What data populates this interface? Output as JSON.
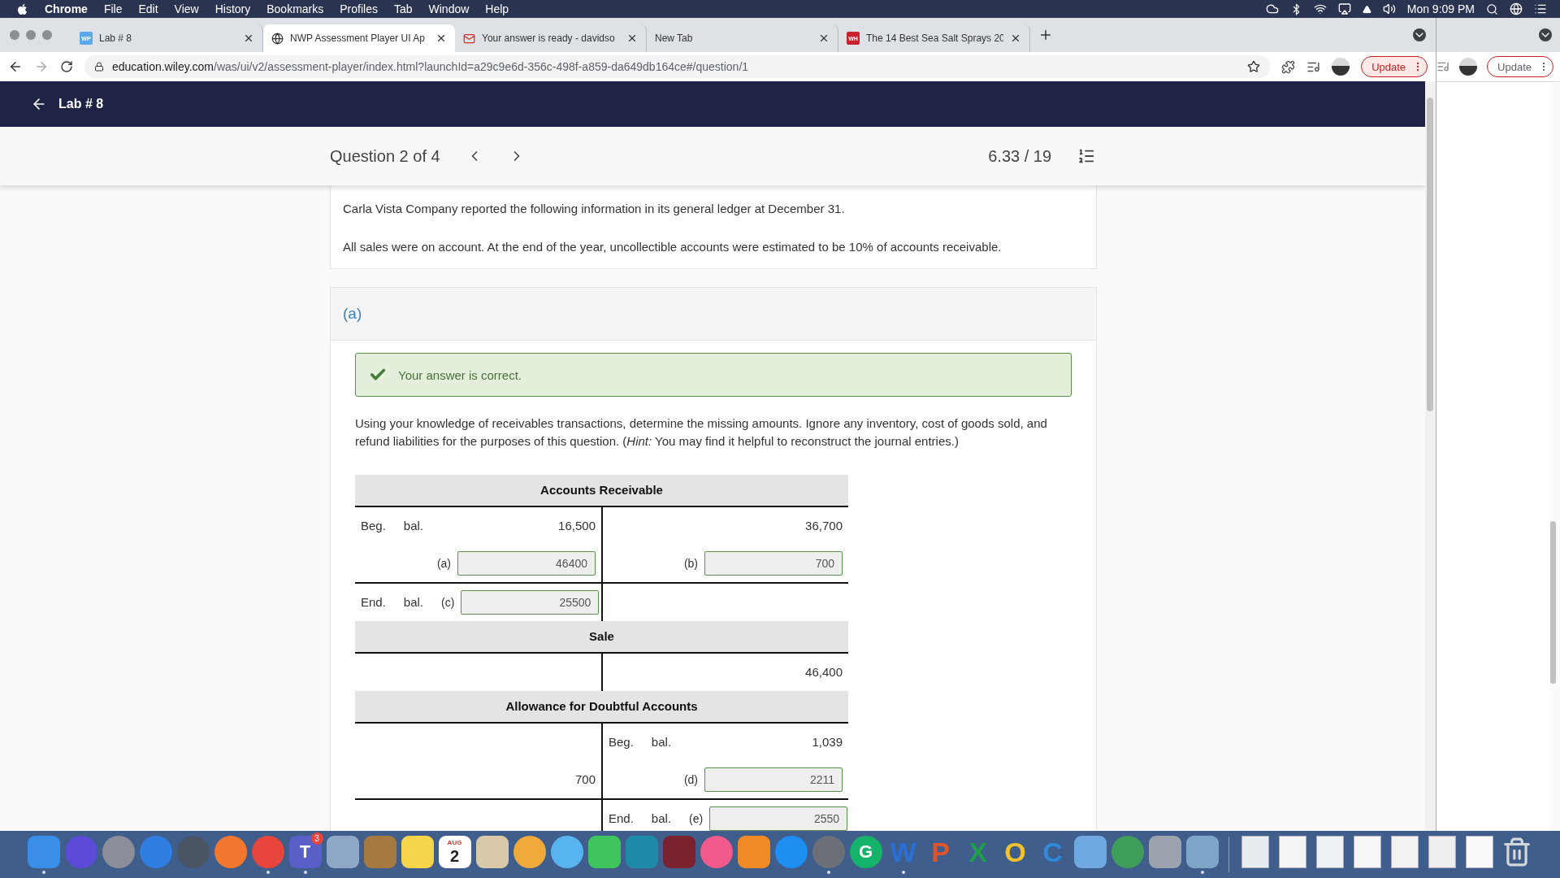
{
  "menubar": {
    "app": "Chrome",
    "items": [
      "File",
      "Edit",
      "View",
      "History",
      "Bookmarks",
      "Profiles",
      "Tab",
      "Window",
      "Help"
    ],
    "clock": "Mon 9:09 PM"
  },
  "tabs": [
    {
      "title": "Lab # 8",
      "kind": "badge",
      "icon_text": "WP",
      "selected": false
    },
    {
      "title": "NWP Assessment Player UI Ap",
      "kind": "globe",
      "selected": true
    },
    {
      "title": "Your answer is ready - davidso",
      "kind": "mail",
      "selected": false
    },
    {
      "title": "New Tab",
      "kind": "plain",
      "selected": false
    },
    {
      "title": "The 14 Best Sea Salt Sprays 20",
      "kind": "badge",
      "icon_text": "WH",
      "selected": false
    }
  ],
  "address": {
    "host": "education.wiley.com",
    "path": "/was/ui/v2/assessment-player/index.html?launchId=a29c9e6d-356c-498f-a859-da649db164ce#/question/1"
  },
  "update_button": "Update",
  "back_window": {
    "update_button": "Update"
  },
  "page": {
    "back_label": "Lab # 8",
    "question": "Question 2 of 4",
    "score": "6.33 / 19",
    "intro": [
      "Carla Vista Company reported the following information in its general ledger at December 31.",
      "All sales were on account. At the end of the year, uncollectible accounts were estimated to be 10% of accounts receivable."
    ],
    "part": {
      "label": "(a)",
      "feedback": {
        "correct": true,
        "text": "Your answer is correct."
      },
      "instructions": "Using your knowledge of receivables transactions, determine the missing amounts. Ignore any inventory, cost of goods sold, and refund liabilities for the purposes of this question. (*Hint:* You may find it helpful to reconstruct the journal entries.)",
      "accounts": [
        {
          "title": "Accounts Receivable",
          "rows": [
            [
              {
                "kind": "amount",
                "labels": [
                  "Beg.",
                  "bal."
                ],
                "value": "16,500"
              },
              {
                "kind": "amount",
                "value": "36,700"
              }
            ],
            [
              {
                "kind": "input",
                "letter": "(a)",
                "value": "46400"
              },
              {
                "kind": "input",
                "letter": "(b)",
                "value": "700"
              }
            ]
          ],
          "balance_rows": [
            [
              {
                "kind": "input",
                "labels": [
                  "End.",
                  "bal."
                ],
                "letter": "(c)",
                "value": "25500"
              },
              {
                "kind": "empty"
              }
            ]
          ]
        },
        {
          "title": "Sale",
          "rows": [
            [
              {
                "kind": "empty"
              },
              {
                "kind": "amount",
                "value": "46,400"
              }
            ]
          ]
        },
        {
          "title": "Allowance for Doubtful Accounts",
          "rows": [
            [
              {
                "kind": "empty"
              },
              {
                "kind": "amount",
                "labels": [
                  "Beg.",
                  "bal."
                ],
                "value": "1,039"
              }
            ],
            [
              {
                "kind": "amount",
                "value": "700"
              },
              {
                "kind": "input",
                "letter": "(d)",
                "value": "2211"
              }
            ]
          ],
          "balance_rows": [
            [
              {
                "kind": "empty"
              },
              {
                "kind": "input",
                "labels": [
                  "End.",
                  "bal."
                ],
                "letter": "(e)",
                "value": "2550"
              }
            ]
          ]
        }
      ]
    }
  },
  "dock": [
    {
      "kind": "app",
      "color": "#3a8ee6",
      "running": true
    },
    {
      "kind": "round",
      "color": "#5b4bd6",
      "running": false
    },
    {
      "kind": "round",
      "color": "#8a8f99",
      "running": false
    },
    {
      "kind": "round",
      "color": "#2e7de0",
      "running": false
    },
    {
      "kind": "round",
      "color": "#4b5563",
      "running": false
    },
    {
      "kind": "round",
      "color": "#f2762e",
      "running": false
    },
    {
      "kind": "round",
      "color": "#e8453c",
      "running": true
    },
    {
      "kind": "app",
      "color": "#5a5fc7",
      "glyph": "T",
      "badge": "3",
      "running": true
    },
    {
      "kind": "app",
      "color": "#8fa8c8",
      "running": false
    },
    {
      "kind": "app",
      "color": "#a4793f",
      "running": false
    },
    {
      "kind": "app",
      "color": "#f7d54a",
      "running": false
    },
    {
      "kind": "calendar",
      "color": "#ffffff",
      "month": "AUG",
      "glyph": "2",
      "running": false
    },
    {
      "kind": "app",
      "color": "#d9c9a8",
      "running": false
    },
    {
      "kind": "round",
      "color": "#f0a93b",
      "running": false
    },
    {
      "kind": "round",
      "color": "#58b4f0",
      "running": false
    },
    {
      "kind": "app",
      "color": "#3dc45a",
      "running": false
    },
    {
      "kind": "app",
      "color": "#1f8aa8",
      "running": false
    },
    {
      "kind": "app",
      "color": "#7b2230",
      "running": false
    },
    {
      "kind": "round",
      "color": "#f05a8a",
      "running": false
    },
    {
      "kind": "app",
      "color": "#f08a24",
      "running": false
    },
    {
      "kind": "round",
      "color": "#1f8ef1",
      "running": false
    },
    {
      "kind": "round",
      "color": "#6b6f76",
      "running": true
    },
    {
      "kind": "round",
      "color": "#15b36a",
      "glyph": "G",
      "running": false
    },
    {
      "kind": "letter",
      "color": "#2b6fd6",
      "glyph": "W",
      "running": true
    },
    {
      "kind": "letter",
      "color": "#e0542c",
      "glyph": "P",
      "running": false
    },
    {
      "kind": "letter",
      "color": "#1f9e4b",
      "glyph": "X",
      "running": false
    },
    {
      "kind": "letter",
      "color": "#f2c12e",
      "glyph": "O",
      "running": false
    },
    {
      "kind": "letter",
      "color": "#2f88d8",
      "glyph": "C",
      "running": false
    },
    {
      "kind": "app",
      "color": "#6fa8e0",
      "running": false
    },
    {
      "kind": "round",
      "color": "#3f9e5a",
      "running": false
    },
    {
      "kind": "app",
      "color": "#9aa3ad",
      "running": false
    },
    {
      "kind": "app",
      "color": "#7fa6c9",
      "running": true
    },
    {
      "kind": "separator"
    },
    {
      "kind": "doc",
      "color": "#e8ecf0",
      "running": false
    },
    {
      "kind": "doc",
      "color": "#f4f4f4",
      "running": false
    },
    {
      "kind": "doc",
      "color": "#eef1f5",
      "running": false
    },
    {
      "kind": "doc",
      "color": "#f6f6f6",
      "running": false
    },
    {
      "kind": "doc",
      "color": "#f2f2f2",
      "running": false
    },
    {
      "kind": "doc",
      "color": "#eeeeee",
      "running": false
    },
    {
      "kind": "doc",
      "color": "#fafafa",
      "running": false
    },
    {
      "kind": "trash",
      "color": "#d4d8dc",
      "running": false
    }
  ]
}
